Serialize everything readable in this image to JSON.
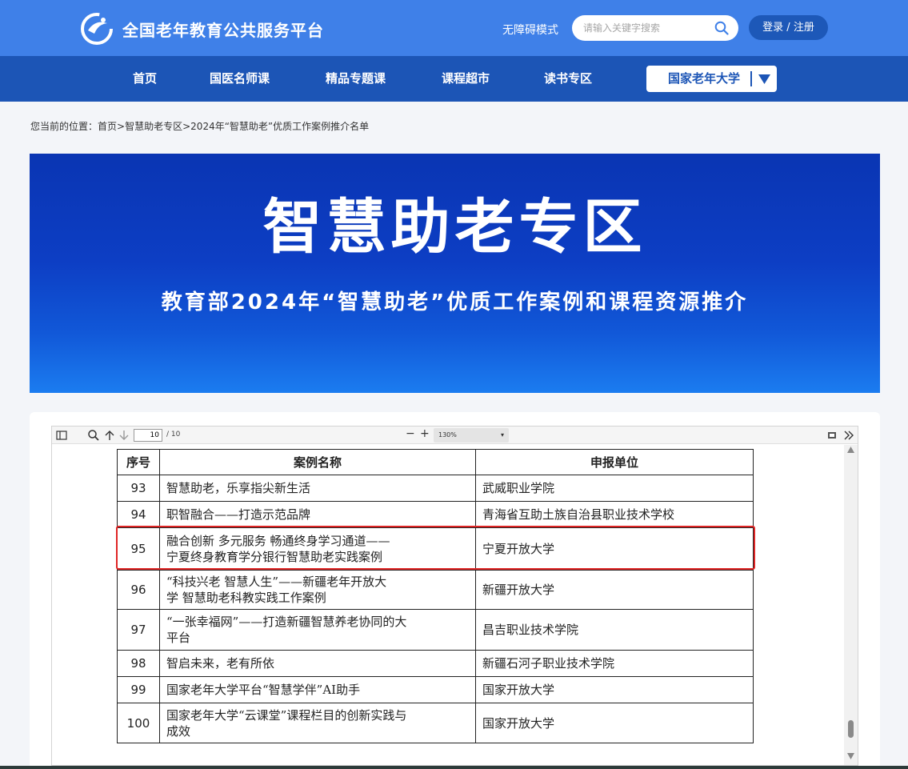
{
  "header": {
    "site_title": "全国老年教育公共服务平台",
    "accessibility_label": "无障碍模式",
    "search_placeholder": "请输入关键字搜索",
    "login_label": "登录 / 注册"
  },
  "nav": {
    "items": [
      {
        "label": "首页"
      },
      {
        "label": "国医名师课"
      },
      {
        "label": "精品专题课"
      },
      {
        "label": "课程超市"
      },
      {
        "label": "读书专区"
      }
    ],
    "university_label": "国家老年大学"
  },
  "breadcrumb": {
    "prefix": "您当前的位置：",
    "items": [
      "首页",
      "智慧助老专区",
      "2024年“智慧助老”优质工作案例推介名单"
    ],
    "separator": ">"
  },
  "banner": {
    "title": "智慧助老专区",
    "subtitle": "教育部2024年“智慧助老”优质工作案例和课程资源推介"
  },
  "pdf_viewer": {
    "current_page": "10",
    "total_pages": "/ 10",
    "zoom": "130%",
    "minus_label": "−",
    "plus_label": "+"
  },
  "table": {
    "headers": [
      "序号",
      "案例名称",
      "申报单位"
    ],
    "rows": [
      {
        "no": "93",
        "name_lines": [
          "智慧助老，乐享指尖新生活"
        ],
        "unit": "武威职业学院"
      },
      {
        "no": "94",
        "name_lines": [
          "职智融合——打造示范品牌"
        ],
        "unit": "青海省互助土族自治县职业技术学校"
      },
      {
        "no": "95",
        "name_lines": [
          "融合创新 多元服务 畅通终身学习通道——",
          "宁夏终身教育学分银行智慧助老实践案例"
        ],
        "unit": "宁夏开放大学"
      },
      {
        "no": "96",
        "name_lines": [
          "“科技兴老 智慧人生”——新疆老年开放大",
          "学 智慧助老科教实践工作案例"
        ],
        "unit": "新疆开放大学"
      },
      {
        "no": "97",
        "name_lines": [
          "“一张幸福网”——打造新疆智慧养老协同的大",
          "平台"
        ],
        "unit": "昌吉职业技术学院"
      },
      {
        "no": "98",
        "name_lines": [
          "智启未来，老有所依"
        ],
        "unit": "新疆石河子职业技术学院"
      },
      {
        "no": "99",
        "name_lines": [
          "国家老年大学平台“智慧学伴”AI助手"
        ],
        "unit": "国家开放大学"
      },
      {
        "no": "100",
        "name_lines": [
          "国家老年大学“云课堂”课程栏目的创新实践与",
          "成效"
        ],
        "unit": "国家开放大学"
      }
    ]
  },
  "colors": {
    "header_blue": "#3f80e8",
    "nav_blue": "#1c55b6",
    "highlight_red": "#e02525"
  },
  "icons": [
    "logo-icon",
    "search-icon",
    "chevron-down-icon",
    "sidebar-toggle-icon",
    "zoom-search-icon",
    "arrow-up-icon",
    "arrow-down-icon",
    "presentation-icon",
    "more-chevron-icon"
  ]
}
